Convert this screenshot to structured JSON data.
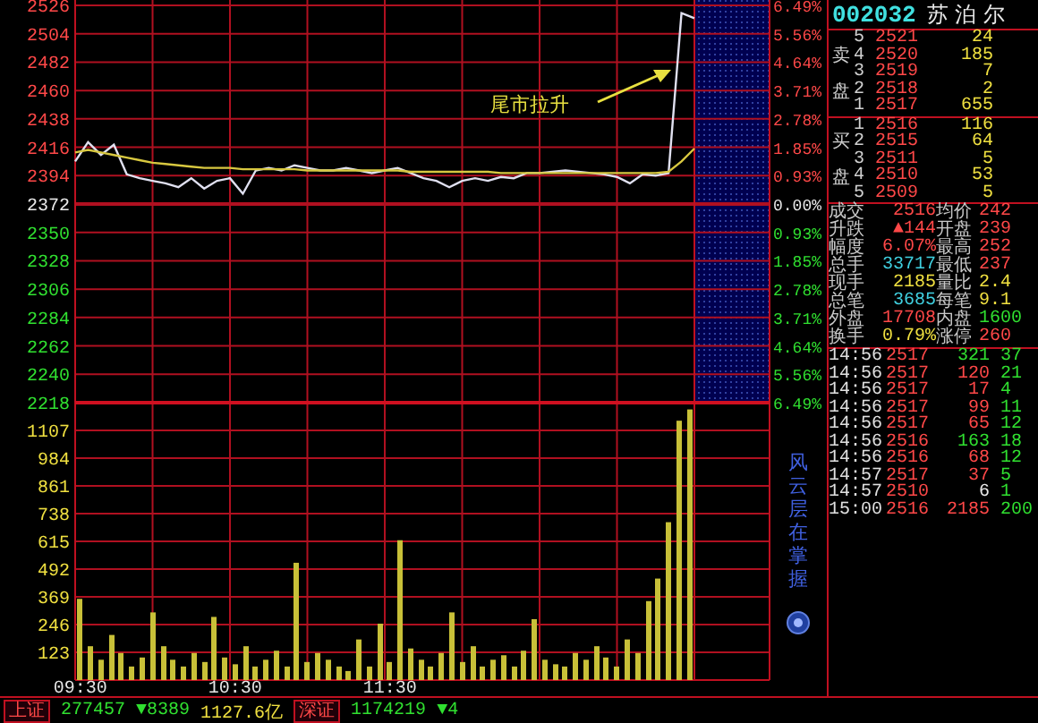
{
  "price_chart": {
    "chart_data": {
      "type": "line",
      "ylim": [
        2218,
        2526
      ],
      "series": [
        {
          "color": "#e0e0f0",
          "values": [
            2405,
            2420,
            2410,
            2418,
            2395,
            2392,
            2390,
            2388,
            2385,
            2392,
            2384,
            2390,
            2392,
            2380,
            2398,
            2400,
            2398,
            2402,
            2400,
            2398,
            2398,
            2400,
            2398,
            2396,
            2398,
            2400,
            2396,
            2392,
            2390,
            2385,
            2390,
            2392,
            2390,
            2393,
            2392,
            2396,
            2396,
            2397,
            2398,
            2397,
            2396,
            2395,
            2393,
            2388,
            2395,
            2394,
            2396,
            2520,
            2516
          ]
        },
        {
          "color": "#d8c840",
          "values": [
            2412,
            2414,
            2412,
            2410,
            2408,
            2406,
            2404,
            2403,
            2402,
            2401,
            2400,
            2400,
            2400,
            2399,
            2399,
            2399,
            2399,
            2399,
            2398,
            2398,
            2398,
            2398,
            2398,
            2398,
            2398,
            2398,
            2397,
            2397,
            2397,
            2397,
            2397,
            2397,
            2397,
            2396,
            2396,
            2396,
            2396,
            2396,
            2396,
            2396,
            2396,
            2396,
            2396,
            2396,
            2396,
            2396,
            2397,
            2405,
            2415
          ]
        }
      ],
      "yticks": [
        2526,
        2504,
        2482,
        2460,
        2438,
        2416,
        2394,
        2372,
        2350,
        2328,
        2306,
        2284,
        2262,
        2240,
        2218
      ]
    },
    "percent_labels": [
      {
        "label": "6.49%",
        "kind": "up"
      },
      {
        "label": "5.56%",
        "kind": "up"
      },
      {
        "label": "4.64%",
        "kind": "up"
      },
      {
        "label": "3.71%",
        "kind": "up"
      },
      {
        "label": "2.78%",
        "kind": "up"
      },
      {
        "label": "1.85%",
        "kind": "up"
      },
      {
        "label": "0.93%",
        "kind": "up"
      },
      {
        "label": "0.00%",
        "kind": "flat"
      },
      {
        "label": "0.93%",
        "kind": "down"
      },
      {
        "label": "1.85%",
        "kind": "down"
      },
      {
        "label": "2.78%",
        "kind": "down"
      },
      {
        "label": "3.71%",
        "kind": "down"
      },
      {
        "label": "4.64%",
        "kind": "down"
      },
      {
        "label": "5.56%",
        "kind": "down"
      },
      {
        "label": "6.49%",
        "kind": "down"
      }
    ],
    "annotation": "尾市拉升"
  },
  "volume_chart": {
    "chart_data": {
      "type": "bar",
      "ylim": [
        0,
        1230
      ],
      "categories": [
        "09:30",
        null,
        null,
        null,
        null,
        null,
        null,
        null,
        null,
        null,
        null,
        null,
        null,
        null,
        null,
        "10:30",
        null,
        null,
        null,
        null,
        null,
        null,
        null,
        null,
        null,
        null,
        null,
        null,
        null,
        null,
        "11:30",
        null,
        null,
        null,
        null,
        null,
        null,
        null,
        null,
        null,
        null,
        null,
        null,
        null,
        null,
        null,
        null,
        null,
        null,
        null,
        null,
        null,
        null,
        null,
        null,
        null,
        null,
        null,
        null,
        null
      ],
      "values": [
        360,
        150,
        90,
        200,
        120,
        60,
        100,
        300,
        150,
        90,
        60,
        120,
        80,
        280,
        100,
        70,
        150,
        60,
        90,
        130,
        60,
        520,
        80,
        120,
        90,
        60,
        40,
        180,
        60,
        250,
        80,
        620,
        140,
        90,
        60,
        120,
        300,
        80,
        150,
        60,
        90,
        110,
        60,
        130,
        270,
        90,
        70,
        60,
        120,
        90,
        150,
        100,
        60,
        180,
        120,
        350,
        450,
        700,
        1150,
        1200
      ],
      "yticks": [
        1107,
        984,
        861,
        738,
        615,
        492,
        369,
        246,
        123
      ]
    }
  },
  "side_caption": "风云层在掌握",
  "quote": {
    "code": "002032",
    "name": "苏 泊 尔",
    "ask_label": "卖盘",
    "asks": [
      {
        "level": "5",
        "price": "2521",
        "volume": "24"
      },
      {
        "level": "4",
        "price": "2520",
        "volume": "185"
      },
      {
        "level": "3",
        "price": "2519",
        "volume": "7"
      },
      {
        "level": "2",
        "price": "2518",
        "volume": "2"
      },
      {
        "level": "1",
        "price": "2517",
        "volume": "655"
      }
    ],
    "bid_label": "买盘",
    "bids": [
      {
        "level": "1",
        "price": "2516",
        "volume": "116"
      },
      {
        "level": "2",
        "price": "2515",
        "volume": "64"
      },
      {
        "level": "3",
        "price": "2511",
        "volume": "5"
      },
      {
        "level": "4",
        "price": "2510",
        "volume": "53"
      },
      {
        "level": "5",
        "price": "2509",
        "volume": "5"
      }
    ],
    "stats": [
      {
        "cells": [
          {
            "label": "成交",
            "value": "2516",
            "color": "#ff4848"
          },
          {
            "label": "均价",
            "value": "242",
            "color": "#ff4848"
          }
        ]
      },
      {
        "cells": [
          {
            "label": "升跌",
            "value": "▲144",
            "color": "#ff4848"
          },
          {
            "label": "开盘",
            "value": "239",
            "color": "#ff4848"
          }
        ]
      },
      {
        "cells": [
          {
            "label": "幅度",
            "value": "6.07%",
            "color": "#ff4848"
          },
          {
            "label": "最高",
            "value": "252",
            "color": "#ff4848"
          }
        ]
      },
      {
        "cells": [
          {
            "label": "总手",
            "value": "33717",
            "color": "#40d0e0"
          },
          {
            "label": "最低",
            "value": "237",
            "color": "#ff4848"
          }
        ]
      },
      {
        "cells": [
          {
            "label": "现手",
            "value": "2185",
            "color": "#f0e040"
          },
          {
            "label": "量比",
            "value": "2.4",
            "color": "#f0e040"
          }
        ]
      },
      {
        "cells": [
          {
            "label": "总笔",
            "value": "3685",
            "color": "#40d0e0"
          },
          {
            "label": "每笔",
            "value": "9.1",
            "color": "#f0e040"
          }
        ]
      },
      {
        "cells": [
          {
            "label": "外盘",
            "value": "17708",
            "color": "#ff4848"
          },
          {
            "label": "内盘",
            "value": "1600",
            "color": "#30e030"
          }
        ]
      },
      {
        "cells": [
          {
            "label": "换手",
            "value": "0.79%",
            "color": "#f0e040"
          },
          {
            "label": "涨停",
            "value": "260",
            "color": "#ff4848"
          }
        ]
      }
    ],
    "trades": [
      {
        "time": "14:56",
        "price": "2517",
        "volume": "321",
        "color": "#30e030",
        "column_4": "37"
      },
      {
        "time": "14:56",
        "price": "2517",
        "volume": "120",
        "color": "#ff4848",
        "column_4": "21"
      },
      {
        "time": "14:56",
        "price": "2517",
        "volume": "17",
        "color": "#ff4848",
        "column_4": "4"
      },
      {
        "time": "14:56",
        "price": "2517",
        "volume": "99",
        "color": "#ff4848",
        "column_4": "11"
      },
      {
        "time": "14:56",
        "price": "2517",
        "volume": "65",
        "color": "#ff4848",
        "column_4": "12"
      },
      {
        "time": "14:56",
        "price": "2516",
        "volume": "163",
        "color": "#30e030",
        "column_4": "18"
      },
      {
        "time": "14:56",
        "price": "2516",
        "volume": "68",
        "color": "#ff4848",
        "column_4": "12"
      },
      {
        "time": "14:57",
        "price": "2517",
        "volume": "37",
        "color": "#ff4848",
        "column_4": "5"
      },
      {
        "time": "14:57",
        "price": "2510",
        "volume": "6",
        "color": "#e8e8e8",
        "column_4": "1"
      },
      {
        "time": "15:00",
        "price": "2516",
        "volume": "2185",
        "color": "#ff4848",
        "column_4": "200"
      }
    ]
  },
  "status_bar": [
    {
      "kind": "market",
      "text": "上证"
    },
    {
      "kind": "value",
      "text": "277457",
      "color": "#30e030"
    },
    {
      "kind": "value",
      "text": "▼8389",
      "color": "#30e030"
    },
    {
      "kind": "value",
      "text": "1127.6亿",
      "color": "#f0e040"
    },
    {
      "kind": "market",
      "text": "深证"
    },
    {
      "kind": "value",
      "text": "1174219",
      "color": "#30e030"
    },
    {
      "kind": "value",
      "text": "▼4",
      "color": "#30e030"
    }
  ]
}
